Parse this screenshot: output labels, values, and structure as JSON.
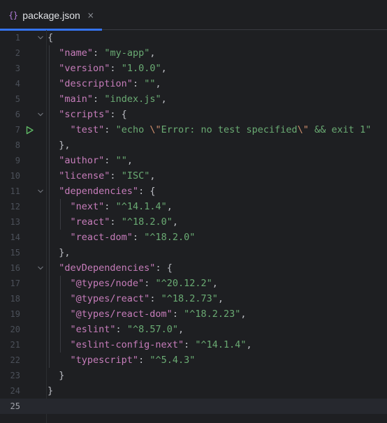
{
  "tab": {
    "icon": "{}",
    "title": "package.json",
    "close": "×"
  },
  "editor": {
    "current_line": 25,
    "lines": [
      {
        "num": "1",
        "fold": "open",
        "tokens": [
          {
            "t": "p",
            "v": "{"
          }
        ]
      },
      {
        "num": "2",
        "tokens": [
          {
            "t": "p",
            "v": "  "
          },
          {
            "t": "k",
            "v": "\"name\""
          },
          {
            "t": "p",
            "v": ": "
          },
          {
            "t": "s",
            "v": "\"my-app\""
          },
          {
            "t": "p",
            "v": ","
          }
        ]
      },
      {
        "num": "3",
        "tokens": [
          {
            "t": "p",
            "v": "  "
          },
          {
            "t": "k",
            "v": "\"version\""
          },
          {
            "t": "p",
            "v": ": "
          },
          {
            "t": "s",
            "v": "\"1.0.0\""
          },
          {
            "t": "p",
            "v": ","
          }
        ]
      },
      {
        "num": "4",
        "tokens": [
          {
            "t": "p",
            "v": "  "
          },
          {
            "t": "k",
            "v": "\"description\""
          },
          {
            "t": "p",
            "v": ": "
          },
          {
            "t": "s",
            "v": "\"\""
          },
          {
            "t": "p",
            "v": ","
          }
        ]
      },
      {
        "num": "5",
        "tokens": [
          {
            "t": "p",
            "v": "  "
          },
          {
            "t": "k",
            "v": "\"main\""
          },
          {
            "t": "p",
            "v": ": "
          },
          {
            "t": "s",
            "v": "\"index.js\""
          },
          {
            "t": "p",
            "v": ","
          }
        ]
      },
      {
        "num": "6",
        "fold": "open",
        "tokens": [
          {
            "t": "p",
            "v": "  "
          },
          {
            "t": "k",
            "v": "\"scripts\""
          },
          {
            "t": "p",
            "v": ": {"
          }
        ]
      },
      {
        "num": "7",
        "run": true,
        "tokens": [
          {
            "t": "p",
            "v": "    "
          },
          {
            "t": "k",
            "v": "\"test\""
          },
          {
            "t": "p",
            "v": ": "
          },
          {
            "t": "s",
            "v": "\"echo "
          },
          {
            "t": "e",
            "v": "\\\""
          },
          {
            "t": "s",
            "v": "Error: no test specified"
          },
          {
            "t": "e",
            "v": "\\\""
          },
          {
            "t": "s",
            "v": " && exit 1\""
          }
        ]
      },
      {
        "num": "8",
        "tokens": [
          {
            "t": "p",
            "v": "  },"
          }
        ]
      },
      {
        "num": "9",
        "tokens": [
          {
            "t": "p",
            "v": "  "
          },
          {
            "t": "k",
            "v": "\"author\""
          },
          {
            "t": "p",
            "v": ": "
          },
          {
            "t": "s",
            "v": "\"\""
          },
          {
            "t": "p",
            "v": ","
          }
        ]
      },
      {
        "num": "10",
        "tokens": [
          {
            "t": "p",
            "v": "  "
          },
          {
            "t": "k",
            "v": "\"license\""
          },
          {
            "t": "p",
            "v": ": "
          },
          {
            "t": "s",
            "v": "\"ISC\""
          },
          {
            "t": "p",
            "v": ","
          }
        ]
      },
      {
        "num": "11",
        "fold": "open",
        "tokens": [
          {
            "t": "p",
            "v": "  "
          },
          {
            "t": "k",
            "v": "\"dependencies\""
          },
          {
            "t": "p",
            "v": ": {"
          }
        ]
      },
      {
        "num": "12",
        "tokens": [
          {
            "t": "p",
            "v": "    "
          },
          {
            "t": "k",
            "v": "\"next\""
          },
          {
            "t": "p",
            "v": ": "
          },
          {
            "t": "s",
            "v": "\"^14.1.4\""
          },
          {
            "t": "p",
            "v": ","
          }
        ]
      },
      {
        "num": "13",
        "tokens": [
          {
            "t": "p",
            "v": "    "
          },
          {
            "t": "k",
            "v": "\"react\""
          },
          {
            "t": "p",
            "v": ": "
          },
          {
            "t": "s",
            "v": "\"^18.2.0\""
          },
          {
            "t": "p",
            "v": ","
          }
        ]
      },
      {
        "num": "14",
        "tokens": [
          {
            "t": "p",
            "v": "    "
          },
          {
            "t": "k",
            "v": "\"react-dom\""
          },
          {
            "t": "p",
            "v": ": "
          },
          {
            "t": "s",
            "v": "\"^18.2.0\""
          }
        ]
      },
      {
        "num": "15",
        "tokens": [
          {
            "t": "p",
            "v": "  },"
          }
        ]
      },
      {
        "num": "16",
        "fold": "open",
        "tokens": [
          {
            "t": "p",
            "v": "  "
          },
          {
            "t": "k",
            "v": "\"devDependencies\""
          },
          {
            "t": "p",
            "v": ": {"
          }
        ]
      },
      {
        "num": "17",
        "tokens": [
          {
            "t": "p",
            "v": "    "
          },
          {
            "t": "k",
            "v": "\"@types/node\""
          },
          {
            "t": "p",
            "v": ": "
          },
          {
            "t": "s",
            "v": "\"^20.12.2\""
          },
          {
            "t": "p",
            "v": ","
          }
        ]
      },
      {
        "num": "18",
        "tokens": [
          {
            "t": "p",
            "v": "    "
          },
          {
            "t": "k",
            "v": "\"@types/react\""
          },
          {
            "t": "p",
            "v": ": "
          },
          {
            "t": "s",
            "v": "\"^18.2.73\""
          },
          {
            "t": "p",
            "v": ","
          }
        ]
      },
      {
        "num": "19",
        "tokens": [
          {
            "t": "p",
            "v": "    "
          },
          {
            "t": "k",
            "v": "\"@types/react-dom\""
          },
          {
            "t": "p",
            "v": ": "
          },
          {
            "t": "s",
            "v": "\"^18.2.23\""
          },
          {
            "t": "p",
            "v": ","
          }
        ]
      },
      {
        "num": "20",
        "tokens": [
          {
            "t": "p",
            "v": "    "
          },
          {
            "t": "k",
            "v": "\"eslint\""
          },
          {
            "t": "p",
            "v": ": "
          },
          {
            "t": "s",
            "v": "\"^8.57.0\""
          },
          {
            "t": "p",
            "v": ","
          }
        ]
      },
      {
        "num": "21",
        "tokens": [
          {
            "t": "p",
            "v": "    "
          },
          {
            "t": "k",
            "v": "\"eslint-config-next\""
          },
          {
            "t": "p",
            "v": ": "
          },
          {
            "t": "s",
            "v": "\"^14.1.4\""
          },
          {
            "t": "p",
            "v": ","
          }
        ]
      },
      {
        "num": "22",
        "tokens": [
          {
            "t": "p",
            "v": "    "
          },
          {
            "t": "k",
            "v": "\"typescript\""
          },
          {
            "t": "p",
            "v": ": "
          },
          {
            "t": "s",
            "v": "\"^5.4.3\""
          }
        ]
      },
      {
        "num": "23",
        "tokens": [
          {
            "t": "p",
            "v": "  }"
          }
        ]
      },
      {
        "num": "24",
        "tokens": [
          {
            "t": "p",
            "v": "}"
          }
        ]
      },
      {
        "num": "25",
        "tokens": []
      }
    ]
  },
  "colors": {
    "background": "#1e1f22",
    "key": "#c77dbb",
    "string": "#6aab73",
    "escape": "#cf8e6d",
    "punctuation": "#bcbec4",
    "accent": "#3574f0",
    "run_icon": "#5fb865"
  }
}
